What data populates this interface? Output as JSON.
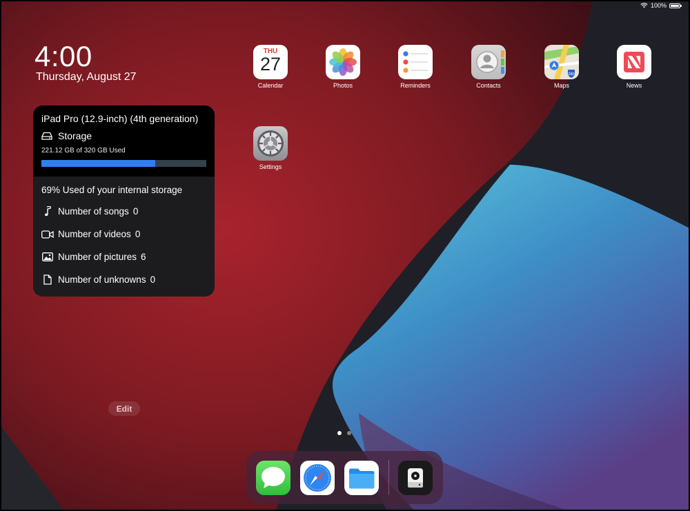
{
  "status_bar": {
    "battery_text": "100%"
  },
  "clock": {
    "time": "4:00",
    "date": "Thursday, August 27"
  },
  "widget": {
    "device_name": "iPad Pro (12.9-inch) (4th generation)",
    "storage_label": "Storage",
    "used_text": "221.12 GB of 320 GB Used",
    "used_fraction": 0.69,
    "summary": "69% Used of your internal storage",
    "stats": [
      {
        "label": "Number of songs",
        "value": "0",
        "icon": "music-note-icon"
      },
      {
        "label": "Number of videos",
        "value": "0",
        "icon": "video-camera-icon"
      },
      {
        "label": "Number of pictures",
        "value": "6",
        "icon": "photo-icon"
      },
      {
        "label": "Number of unknowns",
        "value": "0",
        "icon": "document-icon"
      }
    ]
  },
  "apps": {
    "calendar": {
      "label": "Calendar",
      "day": "THU",
      "date": "27"
    },
    "photos": {
      "label": "Photos"
    },
    "reminders": {
      "label": "Reminders"
    },
    "contacts": {
      "label": "Contacts"
    },
    "maps": {
      "label": "Maps",
      "route_shield": "280"
    },
    "news": {
      "label": "News"
    },
    "settings": {
      "label": "Settings"
    }
  },
  "edit": {
    "label": "Edit"
  },
  "dock": {
    "apps": [
      "messages-icon",
      "safari-icon",
      "files-icon",
      "storage-analyzer-icon"
    ]
  },
  "colors": {
    "storage_bar": "#2f7ef0",
    "bar_track": "#33414a",
    "calendar_day": "#e63b2e"
  }
}
